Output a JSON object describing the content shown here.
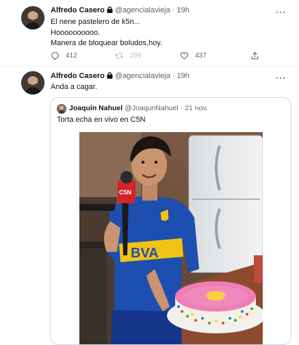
{
  "tweets": [
    {
      "author_name": "Alfredo Casero",
      "handle": "@agencialavieja",
      "time": "19h",
      "lines": [
        "El nene pastelero de k5n...",
        "Hoooooooooo.",
        "Manera de bloquear boludos,hoy."
      ],
      "actions": {
        "replies": "412",
        "retweets": "299",
        "likes": "437"
      }
    },
    {
      "author_name": "Alfredo Casero",
      "handle": "@agencialavieja",
      "time": "19h",
      "lines": [
        "Anda a cagar."
      ],
      "quote": {
        "author_name": "Joaquín Nahuel",
        "handle": "@JoaqunNahuel",
        "date": "21 nov.",
        "text": "Torta echa en vivo en C5N",
        "photo": {
          "mic_flag": "C5N",
          "jersey_text": "BVA"
        }
      }
    }
  ],
  "icons": {
    "reply": "reply-icon",
    "retweet": "retweet-icon",
    "like": "heart-icon",
    "more": "more-dots-icon",
    "protected": "lock-icon"
  },
  "colors": {
    "text": "#0f1419",
    "secondary": "#536471",
    "border": "#cfd9de",
    "jersey_blue": "#1d4fb0",
    "jersey_yellow": "#f2c314",
    "mic_red": "#d2232a",
    "frosting_pink": "#ee7fb6"
  }
}
